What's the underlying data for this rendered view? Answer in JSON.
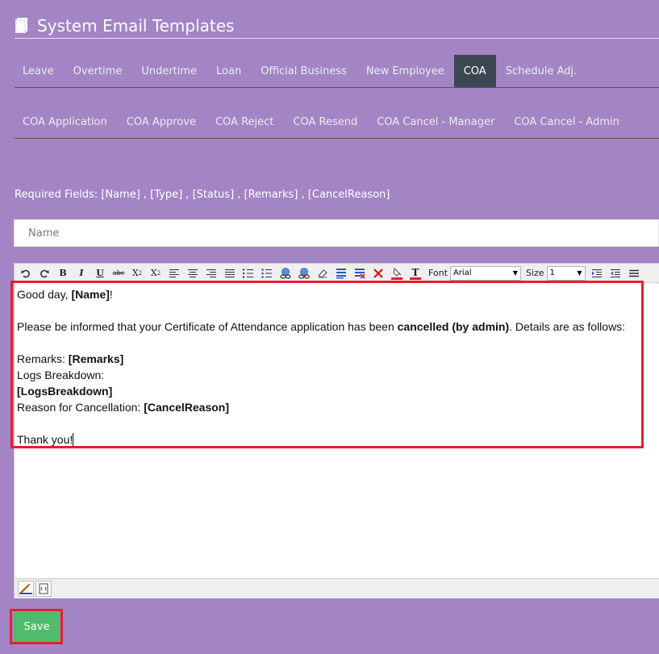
{
  "page": {
    "title": "System Email Templates",
    "title_icon": "book-icon"
  },
  "tabs_primary": [
    {
      "label": "Leave",
      "active": false
    },
    {
      "label": "Overtime",
      "active": false
    },
    {
      "label": "Undertime",
      "active": false
    },
    {
      "label": "Loan",
      "active": false
    },
    {
      "label": "Official Business",
      "active": false
    },
    {
      "label": "New Employee",
      "active": false
    },
    {
      "label": "COA",
      "active": true
    },
    {
      "label": "Schedule Adj.",
      "active": false
    }
  ],
  "tabs_secondary": [
    {
      "label": "COA Application"
    },
    {
      "label": "COA Approve"
    },
    {
      "label": "COA Reject"
    },
    {
      "label": "COA Resend"
    },
    {
      "label": "COA Cancel - Manager"
    },
    {
      "label": "COA Cancel - Admin"
    }
  ],
  "required_fields": "Required Fields: [Name] , [Type] , [Status] , [Remarks] , [CancelReason]",
  "name_input": {
    "placeholder": "Name",
    "value": ""
  },
  "editor": {
    "toolbar": {
      "font_label": "Font",
      "font_value": "Arial",
      "size_label": "Size",
      "size_value": "1"
    },
    "body": {
      "greeting_prefix": "Good day, ",
      "greeting_name": "[Name]",
      "greeting_suffix": "!",
      "informed_prefix": "Please be informed that your Certificate of Attendance application has been ",
      "informed_status": "cancelled (by admin)",
      "informed_suffix": ". Details are as follows:",
      "remarks_label": "Remarks: ",
      "remarks_value": "[Remarks]",
      "logs_label": "Logs Breakdown:",
      "logs_value": "[LogsBreakdown]",
      "reason_label": "Reason for Cancellation: ",
      "reason_value": "[CancelReason]",
      "closing": "Thank you!"
    }
  },
  "actions": {
    "save_label": "Save"
  },
  "colors": {
    "panel_bg": "#a385c5",
    "active_tab_bg": "#3d4752",
    "save_bg": "#4fbb6c",
    "highlight": "#e5202a"
  }
}
